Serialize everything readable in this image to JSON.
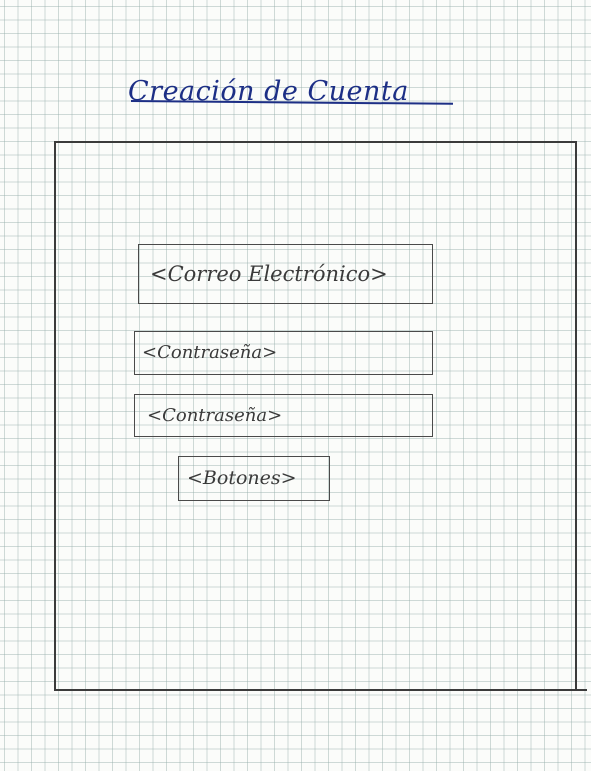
{
  "page": {
    "title": "Creación de Cuenta"
  },
  "form": {
    "email_placeholder": "<Correo Electrónico>",
    "password_placeholder": "<Contraseña>",
    "password_confirm_placeholder": "<Contraseña>",
    "buttons_label": "<Botones>"
  },
  "colors": {
    "title_ink": "#1d2f86",
    "pencil": "#3b3b3b",
    "grid": "#96afac",
    "paper": "#fbfcfa"
  }
}
